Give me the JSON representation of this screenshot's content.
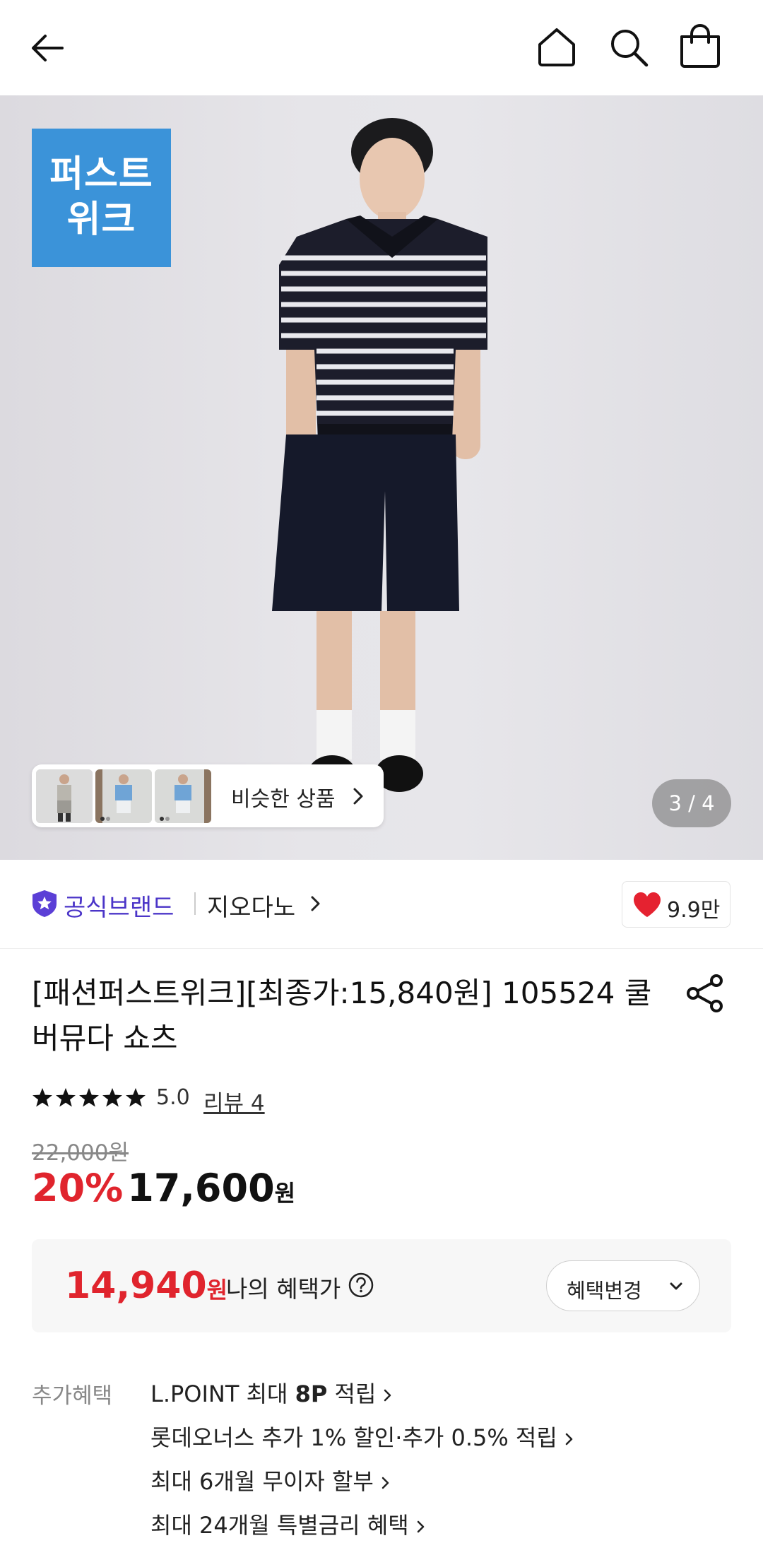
{
  "topbar": {
    "back_icon": "arrow-left-icon",
    "home_icon": "home-icon",
    "search_icon": "search-icon",
    "bag_icon": "shopping-bag-icon"
  },
  "hero": {
    "badge_line1": "퍼스트",
    "badge_line2": "위크",
    "similar_label": "비슷한 상품",
    "counter": "3 / 4"
  },
  "brand": {
    "official_label": "공식브랜드",
    "name": "지오다노",
    "like_count": "9.9만"
  },
  "product": {
    "title": "[패션퍼스트위크][최종가:15,840원] 105524 쿨 버뮤다 쇼츠",
    "rating": 5.0,
    "rating_text": "5.0",
    "review_text": "리뷰 4",
    "original_price": "22,000원",
    "discount": "20%",
    "sale_price": "17,600",
    "sale_unit": "원"
  },
  "benefit": {
    "price": "14,940",
    "unit": "원",
    "label": "나의 혜택가",
    "change_button": "혜택변경"
  },
  "extra": {
    "label": "추가혜택",
    "items": [
      {
        "pre": "L.POINT 최대 ",
        "bold": "8P",
        "post": " 적립"
      },
      {
        "pre": "롯데오너스 추가 1% 할인·추가 0.5% 적립",
        "bold": "",
        "post": ""
      },
      {
        "pre": "최대 6개월 무이자 할부",
        "bold": "",
        "post": ""
      },
      {
        "pre": "최대 24개월 특별금리 혜택",
        "bold": "",
        "post": ""
      }
    ]
  },
  "colors": {
    "accent_red": "#e0242d",
    "brand_purple": "#4b35c8",
    "badge_blue": "#3b93d9"
  }
}
